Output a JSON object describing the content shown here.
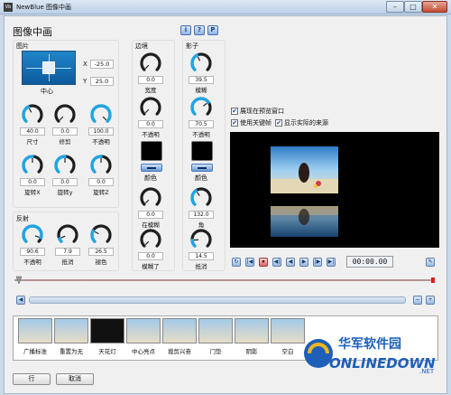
{
  "window": {
    "title": "NewBlue 图像中画",
    "icon": "Vb"
  },
  "heading": "图像中画",
  "help_buttons": [
    "i",
    "?",
    "P"
  ],
  "picture": {
    "section": "图片",
    "position_label": "中心",
    "x_label": "X",
    "x_value": "-25.0",
    "y_label": "Y",
    "y_value": "25.0",
    "knobs": [
      {
        "value": "40.0",
        "label": "尺寸",
        "level": 0.4
      },
      {
        "value": "0.0",
        "label": "修剪",
        "level": 0
      },
      {
        "value": "100.0",
        "label": "不透明",
        "level": 1
      },
      {
        "value": "0.0",
        "label": "旋转X",
        "level": 0.5
      },
      {
        "value": "0.0",
        "label": "旋转y",
        "level": 0.5
      },
      {
        "value": "0.0",
        "label": "旋转Z",
        "level": 0.5
      }
    ]
  },
  "border": {
    "section": "边境",
    "knobs": [
      {
        "value": "0.0",
        "label": "宽度",
        "level": 0
      },
      {
        "value": "0.0",
        "label": "不透明",
        "level": 0
      }
    ],
    "color_label": "颜色",
    "lower_knobs": [
      {
        "value": "0.0",
        "label": "在模糊",
        "level": 0
      },
      {
        "value": "0.0",
        "label": "模糊了",
        "level": 0
      }
    ]
  },
  "shadow": {
    "section": "影子",
    "knobs": [
      {
        "value": "39.5",
        "label": "模糊",
        "level": 0.4
      },
      {
        "value": "70.5",
        "label": "不透明",
        "level": 0.7
      }
    ],
    "color_label": "颜色",
    "lower_knobs": [
      {
        "value": "132.0",
        "label": "角",
        "level": 0.37
      },
      {
        "value": "14.5",
        "label": "抵消",
        "level": 0.15
      }
    ]
  },
  "reflection": {
    "section": "反射",
    "knobs": [
      {
        "value": "90.6",
        "label": "不透明",
        "level": 0.9
      },
      {
        "value": "7.9",
        "label": "抵消",
        "level": 0.08
      },
      {
        "value": "26.5",
        "label": "褪色",
        "level": 0.27
      }
    ]
  },
  "options": [
    {
      "label": "展现在预览窗口",
      "checked": true
    },
    {
      "label": "使用关键帧",
      "checked": true
    },
    {
      "label": "显示实际的来源",
      "checked": true
    }
  ],
  "transport": {
    "buttons": [
      "↻",
      "|◀",
      "⏹",
      "◀|",
      "◀",
      "▶",
      "|▶",
      "▶|",
      "▶▶|"
    ],
    "timecode": "00:00.00",
    "settings_icon": "✎"
  },
  "scroll_buttons": {
    "left": [
      "◀",
      "▶"
    ],
    "right": [
      "−",
      "+"
    ]
  },
  "presets": [
    "广播标准",
    "重置为无",
    "天花灯",
    "中心亮点",
    "裁剪兴奋",
    "门垫",
    "阴影",
    "空白"
  ],
  "footer": {
    "ok": "行",
    "cancel": "取消"
  },
  "watermark": {
    "cn": "华军软件园",
    "en": "ONLINEDOWN",
    "suffix": ".NET"
  },
  "colors": {
    "accent": "#1a6fd8",
    "knob_arc": "#1ba7e8",
    "preview_bg": "#000000",
    "timeline_marker": "#e01c1c"
  }
}
